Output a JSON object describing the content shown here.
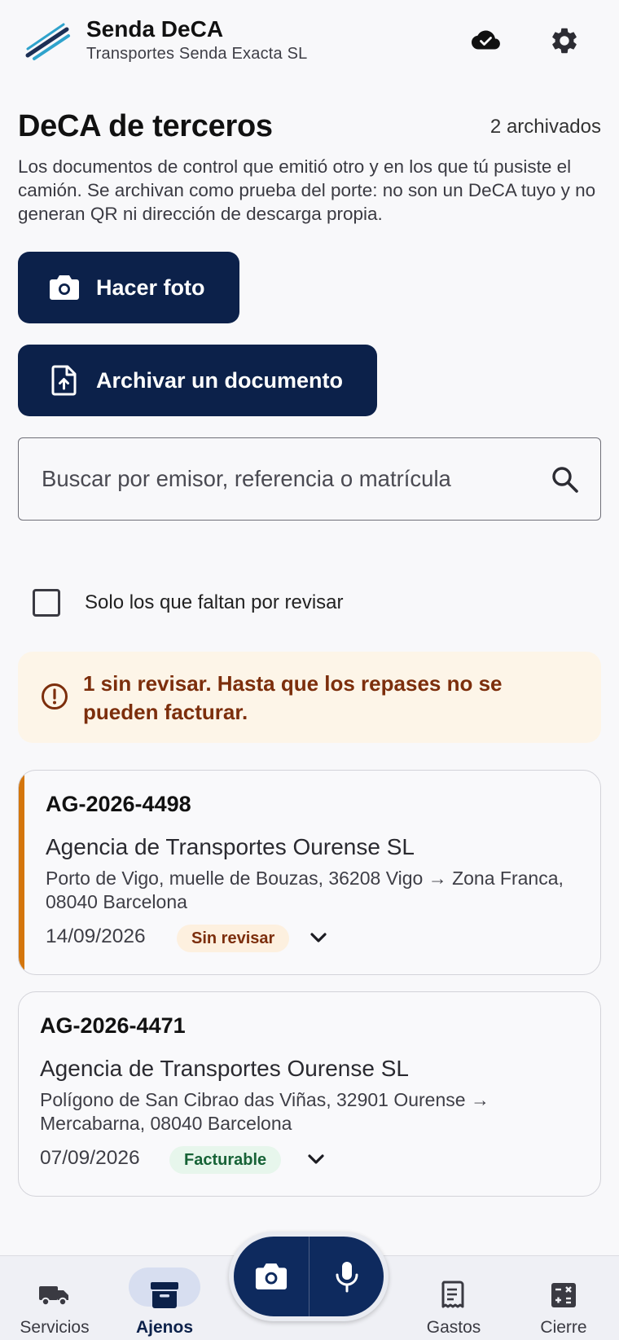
{
  "header": {
    "app_title": "Senda DeCA",
    "company": "Transportes Senda Exacta SL"
  },
  "page": {
    "title": "DeCA de terceros",
    "archived_count": "2 archivados",
    "description": "Los documentos de control que emitió otro y en los que tú pusiste el camión. Se archivan como prueba del porte: no son un DeCA tuyo y no generan QR ni dirección de descarga propia."
  },
  "actions": {
    "photo_label": "Hacer foto",
    "archive_label": "Archivar un documento"
  },
  "search": {
    "placeholder": "Buscar por emisor, referencia o matrícula",
    "value": ""
  },
  "filter": {
    "label": "Solo los que faltan por revisar",
    "checked": false
  },
  "warning": {
    "text": "1 sin revisar. Hasta que los repases no se pueden facturar."
  },
  "documents": [
    {
      "reference": "AG-2026-4498",
      "issuer": "Agencia de Transportes Ourense SL",
      "route": "Porto de Vigo, muelle de Bouzas, 36208 Vigo → Zona Franca, 08040 Barcelona",
      "date": "14/09/2026",
      "status": "Sin revisar",
      "accent_color": "#d4760c"
    },
    {
      "reference": "AG-2026-4471",
      "issuer": "Agencia de Transportes Ourense SL",
      "route": "Polígono de San Cibrao das Viñas, 32901 Ourense → Mercabarna, 08040 Barcelona",
      "date": "07/09/2026",
      "status": "Facturable"
    }
  ],
  "nav": {
    "items": [
      {
        "label": "Servicios",
        "icon": "truck-icon"
      },
      {
        "label": "Ajenos",
        "icon": "archive-icon",
        "active": true
      },
      {
        "label": "Gastos",
        "icon": "receipt-icon"
      },
      {
        "label": "Cierre",
        "icon": "calculator-icon"
      }
    ]
  },
  "colors": {
    "primary": "#0c214a",
    "warning_text": "#7c2e0c",
    "pending_accent": "#d4760c",
    "ok_text": "#166236"
  }
}
